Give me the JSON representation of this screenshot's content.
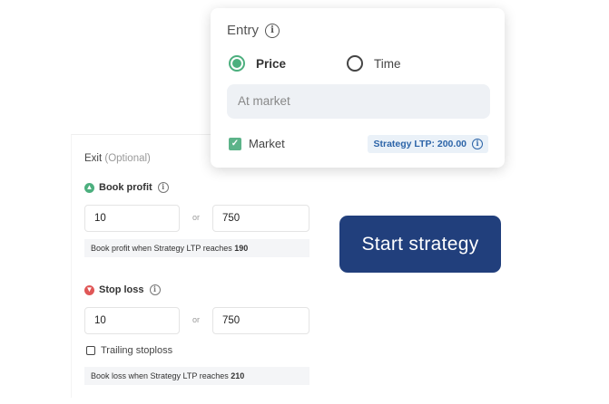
{
  "entry": {
    "title": "Entry",
    "options": [
      {
        "label": "Price",
        "selected": true
      },
      {
        "label": "Time",
        "selected": false
      }
    ],
    "input_value": "At market",
    "market_label": "Market",
    "market_checked": true,
    "strategy_ltp": "Strategy LTP: 200.00"
  },
  "exit": {
    "title": "Exit",
    "optional_label": "(Optional)",
    "book_profit": {
      "label": "Book profit",
      "value1": "10",
      "or_label": "or",
      "value2": "750",
      "note_prefix": "Book profit when Strategy LTP reaches",
      "note_value": "190"
    },
    "stop_loss": {
      "label": "Stop loss",
      "value1": "10",
      "or_label": "or",
      "value2": "750",
      "note_prefix": "Book loss when Strategy LTP reaches",
      "note_value": "210"
    },
    "trailing_label": "Trailing stoploss",
    "trailing_checked": false
  },
  "start_button": "Start strategy",
  "colors": {
    "accent_green": "#4caf7e",
    "accent_red": "#e05757",
    "button_blue": "#213f7c",
    "ltp_blue": "#2c64a8"
  }
}
